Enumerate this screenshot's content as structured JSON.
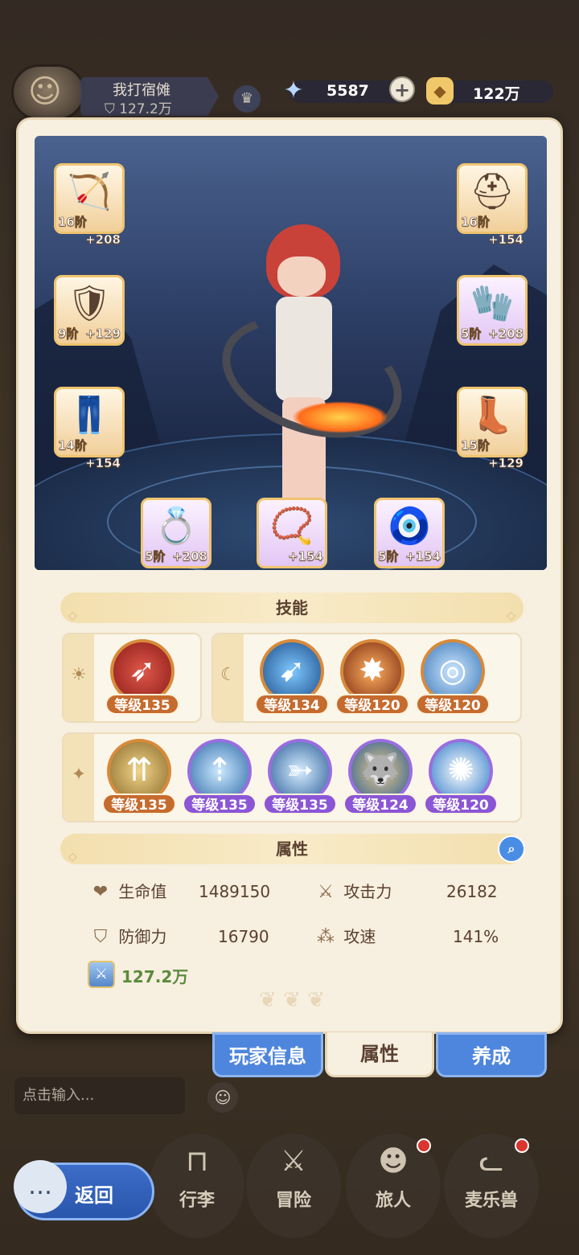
{
  "player": {
    "name": "我打宿傩",
    "power": "127.2万"
  },
  "resources": {
    "stars": "5587",
    "gold": "122万"
  },
  "equipment": [
    {
      "slot": "weapon",
      "level": "16阶",
      "plus": "+208",
      "icon": "bow-icon"
    },
    {
      "slot": "helmet",
      "level": "16阶",
      "plus": "+154",
      "icon": "helmet-icon"
    },
    {
      "slot": "armor",
      "level": "9阶",
      "plus": "+129",
      "icon": "armor-icon"
    },
    {
      "slot": "gloves",
      "level": "5阶",
      "plus": "+208",
      "icon": "glove-icon"
    },
    {
      "slot": "pants",
      "level": "14阶",
      "plus": "+154",
      "icon": "pants-icon"
    },
    {
      "slot": "boots",
      "level": "15阶",
      "plus": "+129",
      "icon": "boots-icon"
    },
    {
      "slot": "ring",
      "level": "5阶",
      "plus": "+208",
      "icon": "ring-icon"
    },
    {
      "slot": "necklace",
      "level": "",
      "plus": "+154",
      "icon": "necklace-icon"
    },
    {
      "slot": "amulet",
      "level": "5阶",
      "plus": "+154",
      "icon": "amulet-icon"
    }
  ],
  "sections": {
    "skills_title": "技能",
    "attributes_title": "属性"
  },
  "skills": {
    "sun": [
      {
        "level": "等级135",
        "color": "orange"
      }
    ],
    "moon": [
      {
        "level": "等级134",
        "color": "orange"
      },
      {
        "level": "等级120",
        "color": "orange"
      },
      {
        "level": "等级120",
        "color": "orange"
      }
    ],
    "star": [
      {
        "level": "等级135",
        "color": "orange"
      },
      {
        "level": "等级135",
        "color": "purple"
      },
      {
        "level": "等级135",
        "color": "purple"
      },
      {
        "level": "等级124",
        "color": "purple"
      },
      {
        "level": "等级120",
        "color": "purple"
      }
    ]
  },
  "attributes": {
    "hp_label": "生命值",
    "hp": "1489150",
    "atk_label": "攻击力",
    "atk": "26182",
    "def_label": "防御力",
    "def": "16790",
    "spd_label": "攻速",
    "spd": "141%",
    "power": "127.2万"
  },
  "tabs": {
    "player_info": "玩家信息",
    "attributes": "属性",
    "develop": "养成"
  },
  "chat": {
    "placeholder": "点击输入..."
  },
  "nav": {
    "back": "返回",
    "bag": "行李",
    "adventure": "冒险",
    "traveler": "旅人",
    "beast": "麦乐兽"
  },
  "colors": {
    "accent_blue": "#4f86dd",
    "panel_bg": "#f7efe0",
    "orange_skill": "#c66b2e",
    "purple_skill": "#8b56d6"
  }
}
